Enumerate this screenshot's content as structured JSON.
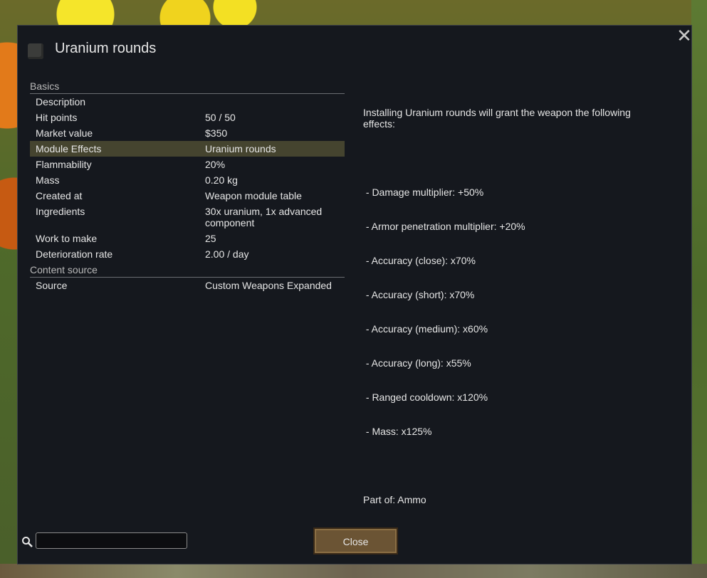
{
  "dialog": {
    "title": "Uranium rounds",
    "close_button_label": "Close",
    "close_x_label": "✕",
    "search_value": ""
  },
  "sections": [
    {
      "header": "Basics",
      "rows": [
        {
          "label": "Description",
          "value": ""
        },
        {
          "label": "Hit points",
          "value": "50 / 50"
        },
        {
          "label": "Market value",
          "value": "$350"
        },
        {
          "label": "Module Effects",
          "value": "Uranium rounds",
          "selected": true
        },
        {
          "label": "Flammability",
          "value": "20%"
        },
        {
          "label": "Mass",
          "value": "0.20 kg"
        },
        {
          "label": "Created at",
          "value": "Weapon module table"
        },
        {
          "label": "Ingredients",
          "value": "30x uranium, 1x advanced component"
        },
        {
          "label": "Work to make",
          "value": "25"
        },
        {
          "label": "Deterioration rate",
          "value": "2.00 / day"
        }
      ]
    },
    {
      "header": "Content source",
      "rows": [
        {
          "label": "Source",
          "value": "Custom Weapons Expanded"
        }
      ]
    }
  ],
  "detail": {
    "intro": "Installing Uranium rounds will grant the weapon the following effects:",
    "effects": [
      " - Damage multiplier: +50%",
      " - Armor penetration multiplier: +20%",
      " - Accuracy (close): x70%",
      " - Accuracy (short): x70%",
      " - Accuracy (medium): x60%",
      " - Accuracy (long): x55%",
      " - Ranged cooldown: x120%",
      " - Mass: x125%"
    ],
    "part_of": "Part of: Ammo"
  },
  "colors": {
    "dialog_bg": "#15181e",
    "highlight_row": "#45442f",
    "button_bg": "#6b5434"
  },
  "icons": {
    "title_icon": "ammo-item-icon",
    "search_icon": "magnifier-icon",
    "close_icon": "close-x-icon"
  }
}
